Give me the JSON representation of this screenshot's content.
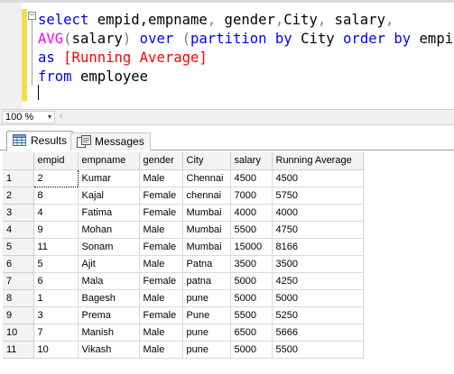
{
  "editor": {
    "lines": [
      [
        "select empid,empname, gender,City, salary,"
      ],
      [
        "AVG(salary) over (partition by City order by empid)"
      ],
      [
        "as [Running Average]"
      ],
      [
        "from employee"
      ]
    ],
    "code": {
      "l1_select": "select",
      "l1_cols": " empid,empname",
      "l1_comma1": ",",
      "l1_gender": " gender",
      "l1_comma2": ",",
      "l1_city": "City",
      "l1_comma3": ",",
      "l1_salary": " salary",
      "l1_comma4": ",",
      "l2_avg": "AVG",
      "l2_open": "(",
      "l2_arg": "salary",
      "l2_close": ")",
      "l2_over": " over ",
      "l2_paren": "(",
      "l2_partition": "partition by",
      "l2_city": " City ",
      "l2_order": "order by",
      "l2_empid": " empid",
      "l2_end": ")",
      "l3_as": "as",
      "l3_alias": " [Running Average]",
      "l4_from": "from",
      "l4_table": " employee"
    },
    "colors": {
      "keyword": "#0000ff",
      "function": "#ff00ff",
      "alias": "#ff0000",
      "operator": "#808080",
      "change_bar": "#f5dc4a"
    },
    "collapse_glyph": "−"
  },
  "zoom": {
    "value": "100 %",
    "arrow": "▾",
    "scroll_left": "‹"
  },
  "tabs": [
    {
      "label": "Results",
      "icon": "grid-icon",
      "active": true
    },
    {
      "label": "Messages",
      "icon": "messages-icon",
      "active": false
    }
  ],
  "grid": {
    "columns": [
      "empid",
      "empname",
      "gender",
      "City",
      "salary",
      "Running Average"
    ],
    "rows": [
      [
        "1",
        "2",
        "Kumar",
        "Male",
        "Chennai",
        "4500",
        "4500"
      ],
      [
        "2",
        "8",
        "Kajal",
        "Female",
        "chennai",
        "7000",
        "5750"
      ],
      [
        "3",
        "4",
        "Fatima",
        "Female",
        "Mumbai",
        "4000",
        "4000"
      ],
      [
        "4",
        "9",
        "Mohan",
        "Male",
        "Mumbai",
        "5500",
        "4750"
      ],
      [
        "5",
        "11",
        "Sonam",
        "Female",
        "Mumbai",
        "15000",
        "8166"
      ],
      [
        "6",
        "5",
        "Ajit",
        "Male",
        "Patna",
        "3500",
        "3500"
      ],
      [
        "7",
        "6",
        "Mala",
        "Female",
        "patna",
        "5000",
        "4250"
      ],
      [
        "8",
        "1",
        "Bagesh",
        "Male",
        "pune",
        "5000",
        "5000"
      ],
      [
        "9",
        "3",
        "Prema",
        "Female",
        "Pune",
        "5500",
        "5250"
      ],
      [
        "10",
        "7",
        "Manish",
        "Male",
        "pune",
        "6500",
        "5666"
      ],
      [
        "11",
        "10",
        "Vikash",
        "Male",
        "pune",
        "5000",
        "5500"
      ]
    ]
  }
}
